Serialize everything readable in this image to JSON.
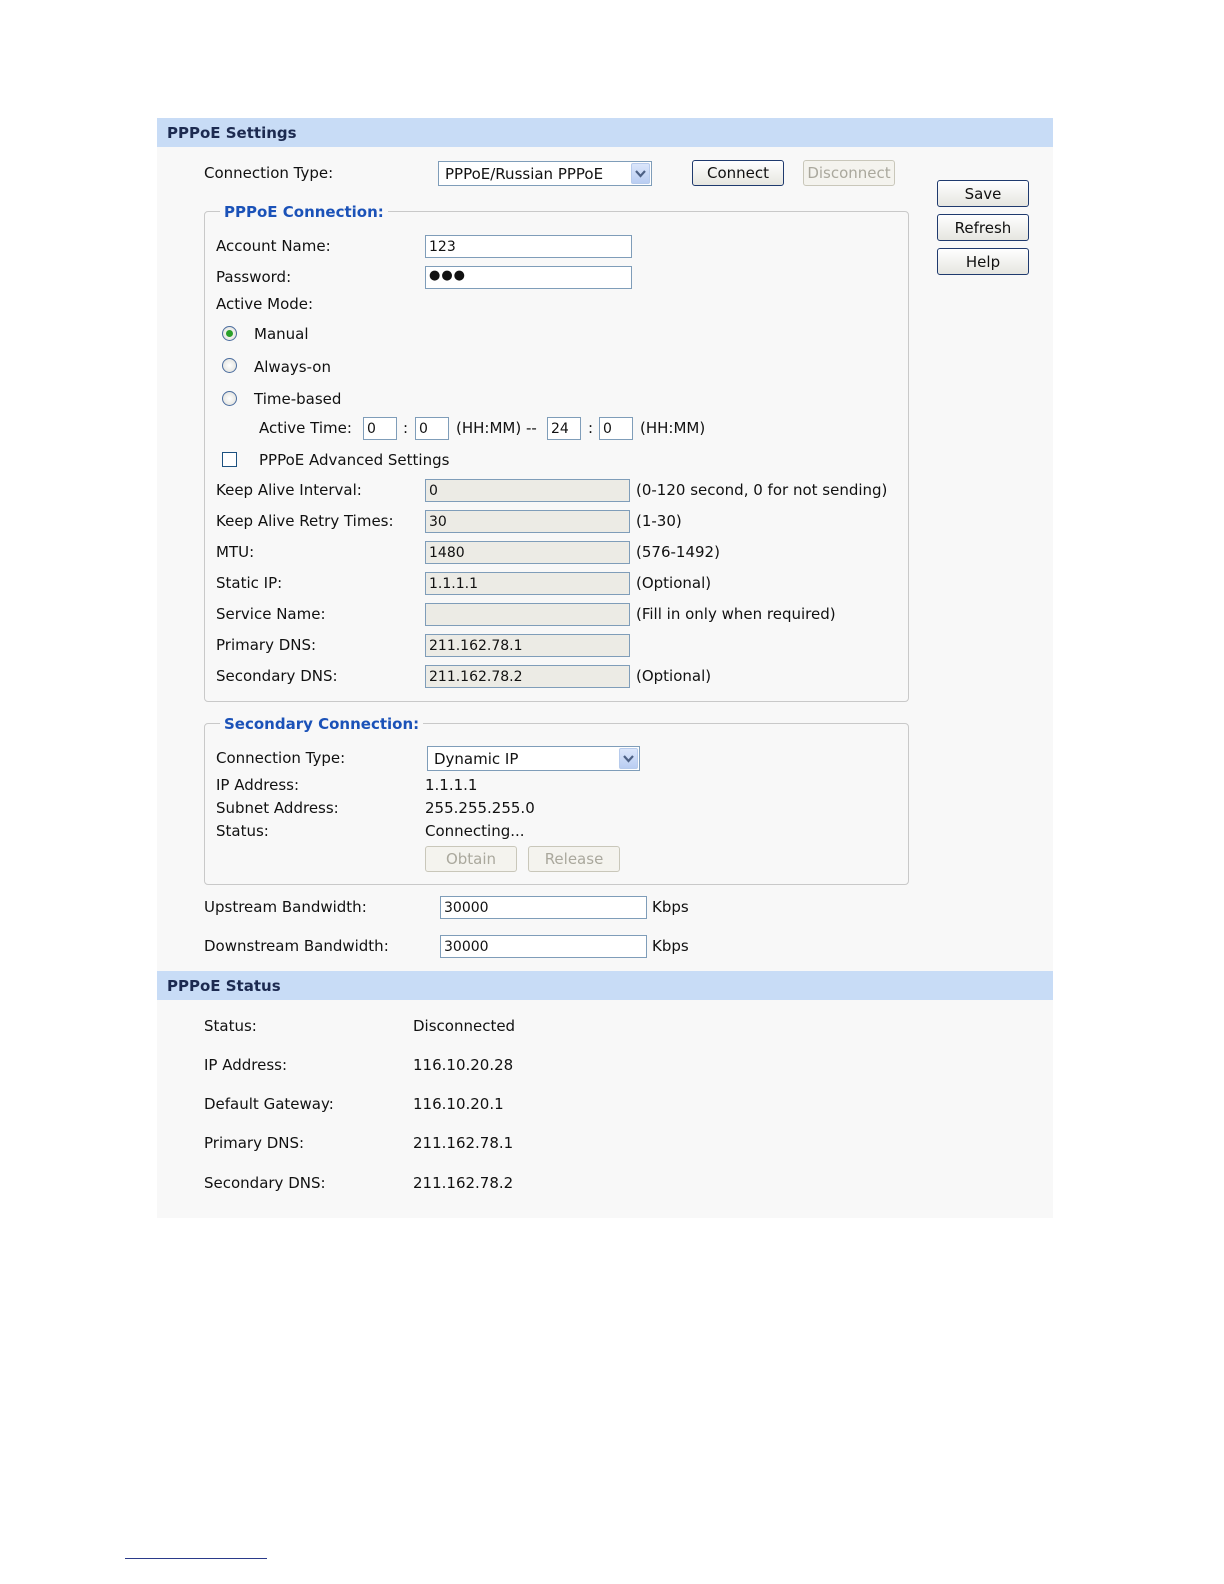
{
  "settings": {
    "header": "PPPoE Settings",
    "connection_type_label": "Connection Type:",
    "connection_type_value": "PPPoE/Russian PPPoE",
    "connect_label": "Connect",
    "disconnect_label": "Disconnect"
  },
  "side_buttons": {
    "save": "Save",
    "refresh": "Refresh",
    "help": "Help"
  },
  "pppoe": {
    "legend": "PPPoE Connection:",
    "account_name_label": "Account Name:",
    "account_name_value": "123",
    "password_label": "Password:",
    "password_value": "●●●",
    "active_mode_label": "Active Mode:",
    "mode_manual": "Manual",
    "mode_always_on": "Always-on",
    "mode_time_based": "Time-based",
    "active_time_label": "Active Time:",
    "start_hh": "0",
    "start_mm": "0",
    "hhmm_sep": "(HH:MM) --",
    "end_hh": "24",
    "end_mm": "0",
    "hhmm_end": "(HH:MM)",
    "colon": ":",
    "advanced_label": "PPPoE Advanced Settings",
    "keep_alive_interval_label": "Keep Alive Interval:",
    "keep_alive_interval_value": "0",
    "keep_alive_interval_hint": "(0-120 second, 0 for not sending)",
    "keep_alive_retry_label": "Keep Alive Retry Times:",
    "keep_alive_retry_value": "30",
    "keep_alive_retry_hint": "(1-30)",
    "mtu_label": "MTU:",
    "mtu_value": "1480",
    "mtu_hint": "(576-1492)",
    "static_ip_label": "Static IP:",
    "static_ip_value": "1.1.1.1",
    "static_ip_hint": "(Optional)",
    "service_name_label": "Service Name:",
    "service_name_value": "",
    "service_name_hint": "(Fill in only when required)",
    "primary_dns_label": "Primary DNS:",
    "primary_dns_value": "211.162.78.1",
    "secondary_dns_label": "Secondary DNS:",
    "secondary_dns_value": "211.162.78.2",
    "secondary_dns_hint": "(Optional)"
  },
  "secondary": {
    "legend": "Secondary Connection:",
    "connection_type_label": "Connection Type:",
    "connection_type_value": "Dynamic IP",
    "ip_label": "IP Address:",
    "ip_value": "1.1.1.1",
    "subnet_label": "Subnet Address:",
    "subnet_value": "255.255.255.0",
    "status_label": "Status:",
    "status_value": "Connecting...",
    "obtain_label": "Obtain",
    "release_label": "Release"
  },
  "bandwidth": {
    "upstream_label": "Upstream Bandwidth:",
    "upstream_value": "30000",
    "downstream_label": "Downstream Bandwidth:",
    "downstream_value": "30000",
    "unit": "Kbps"
  },
  "status": {
    "header": "PPPoE Status",
    "status_label": "Status:",
    "status_value": "Disconnected",
    "ip_label": "IP Address:",
    "ip_value": "116.10.20.28",
    "gateway_label": "Default Gateway:",
    "gateway_value": "116.10.20.1",
    "primary_dns_label": "Primary DNS:",
    "primary_dns_value": "211.162.78.1",
    "secondary_dns_label": "Secondary DNS:",
    "secondary_dns_value": "211.162.78.2"
  }
}
